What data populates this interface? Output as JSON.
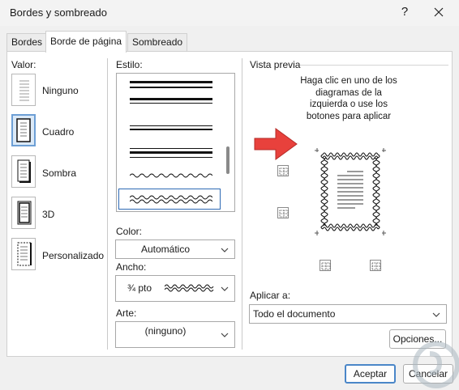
{
  "window": {
    "title": "Bordes y sombreado",
    "help_glyph": "?",
    "close_icon": "close-icon"
  },
  "tabs": [
    {
      "label": "Bordes",
      "active": false
    },
    {
      "label": "Borde de página",
      "active": true
    },
    {
      "label": "Sombreado",
      "active": false
    }
  ],
  "setting": {
    "label": "Valor:",
    "options": [
      {
        "label": "Ninguno",
        "selected": false
      },
      {
        "label": "Cuadro",
        "selected": true
      },
      {
        "label": "Sombra",
        "selected": false
      },
      {
        "label": "3D",
        "selected": false
      },
      {
        "label": "Personalizado",
        "selected": false
      }
    ]
  },
  "style": {
    "label": "Estilo:",
    "selected_style": "wave-double"
  },
  "color": {
    "label": "Color:",
    "value": "Automático"
  },
  "width": {
    "label": "Ancho:",
    "value": "¾ pto"
  },
  "art": {
    "label": "Arte:",
    "value": "(ninguno)"
  },
  "preview": {
    "label": "Vista previa",
    "hint_lines": [
      "Haga clic en uno de los",
      "diagramas de la",
      "izquierda o use los",
      "botones para aplicar"
    ],
    "apply_to_label": "Aplicar a:",
    "apply_to_value": "Todo el documento",
    "options_button": "Opciones..."
  },
  "footer": {
    "ok_button": "Aceptar",
    "cancel_button": "Cancelar"
  },
  "colors": {
    "selection_border": "#2e6ab5",
    "selected_icon_bg": "#dbe9f7",
    "arrow_red": "#e8413c",
    "dialog_bg": "#f0f0f0"
  }
}
